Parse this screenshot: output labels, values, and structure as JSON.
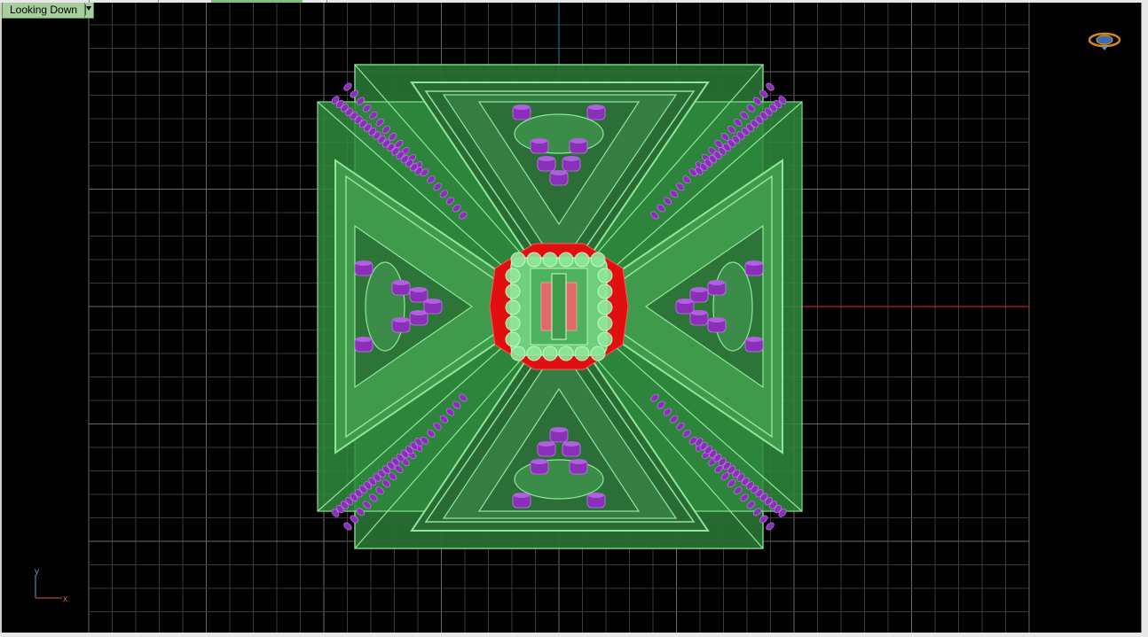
{
  "viewport": {
    "view_label": "Looking Down",
    "axis_labels": {
      "x": "x",
      "y": "y"
    },
    "colors": {
      "background": "#000000",
      "grid": "#3a3a3a",
      "grid_major": "#6a6a6a",
      "x_axis": "#c81e1e",
      "y_axis": "#1e7fa8",
      "model_fill": "#2f8a3e",
      "model_light": "#4fb25e",
      "model_edge": "#7fe08a",
      "purple_parts": "#8a2fb8",
      "red_parts": "#e01010"
    },
    "icons": {
      "navigation_cube": "globe-navigation-icon",
      "view_menu": "chevron-down-icon"
    }
  }
}
